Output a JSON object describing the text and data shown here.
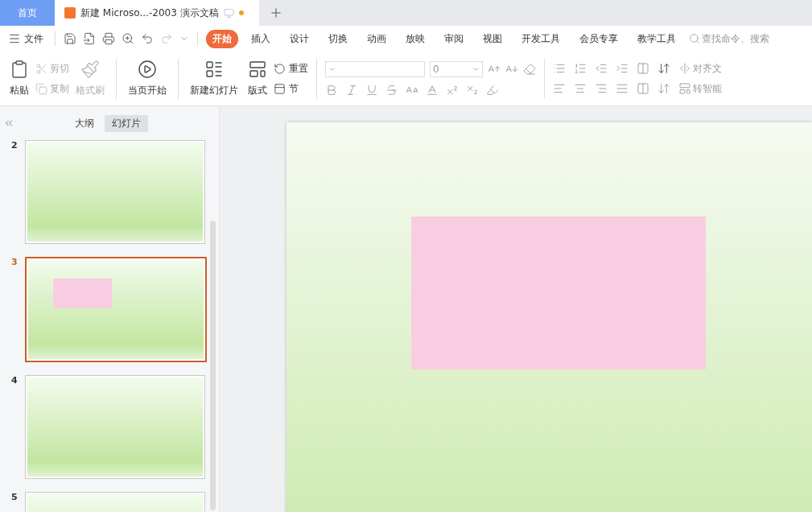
{
  "tabs": [
    {
      "label": "首页",
      "kind": "home",
      "selected": false
    },
    {
      "label": "新建 Microso...-2003 演示文稿",
      "kind": "document",
      "selected": true,
      "unsaved": true
    }
  ],
  "menu": {
    "file": "文件",
    "items": [
      {
        "label": "开始",
        "selected": true
      },
      {
        "label": "插入",
        "selected": false
      },
      {
        "label": "设计",
        "selected": false
      },
      {
        "label": "切换",
        "selected": false
      },
      {
        "label": "动画",
        "selected": false
      },
      {
        "label": "放映",
        "selected": false
      },
      {
        "label": "审阅",
        "selected": false
      },
      {
        "label": "视图",
        "selected": false
      },
      {
        "label": "开发工具",
        "selected": false
      },
      {
        "label": "会员专享",
        "selected": false
      },
      {
        "label": "教学工具",
        "selected": false
      }
    ],
    "search_placeholder": "查找命令、搜索"
  },
  "ribbon": {
    "paste": "粘贴",
    "clipboard": [
      {
        "label": "剪切",
        "disabled": true
      },
      {
        "label": "复制",
        "disabled": true
      }
    ],
    "format_painter": {
      "label": "格式刷",
      "disabled": true
    },
    "play": "当页开始",
    "new_slide": "新建幻灯片",
    "layout": "版式",
    "reset": "重置",
    "section": "节",
    "font_size": "0",
    "align_text": "对齐文",
    "smart_art": "转智能"
  },
  "sidebar": {
    "views": [
      {
        "label": "大纲",
        "selected": false
      },
      {
        "label": "幻灯片",
        "selected": true
      }
    ],
    "slides": [
      {
        "number": "2",
        "selected": false,
        "kind": "blank"
      },
      {
        "number": "3",
        "selected": true,
        "kind": "rectangle"
      },
      {
        "number": "4",
        "selected": false,
        "kind": "blank"
      },
      {
        "number": "5",
        "selected": false,
        "kind": "blank"
      }
    ]
  }
}
